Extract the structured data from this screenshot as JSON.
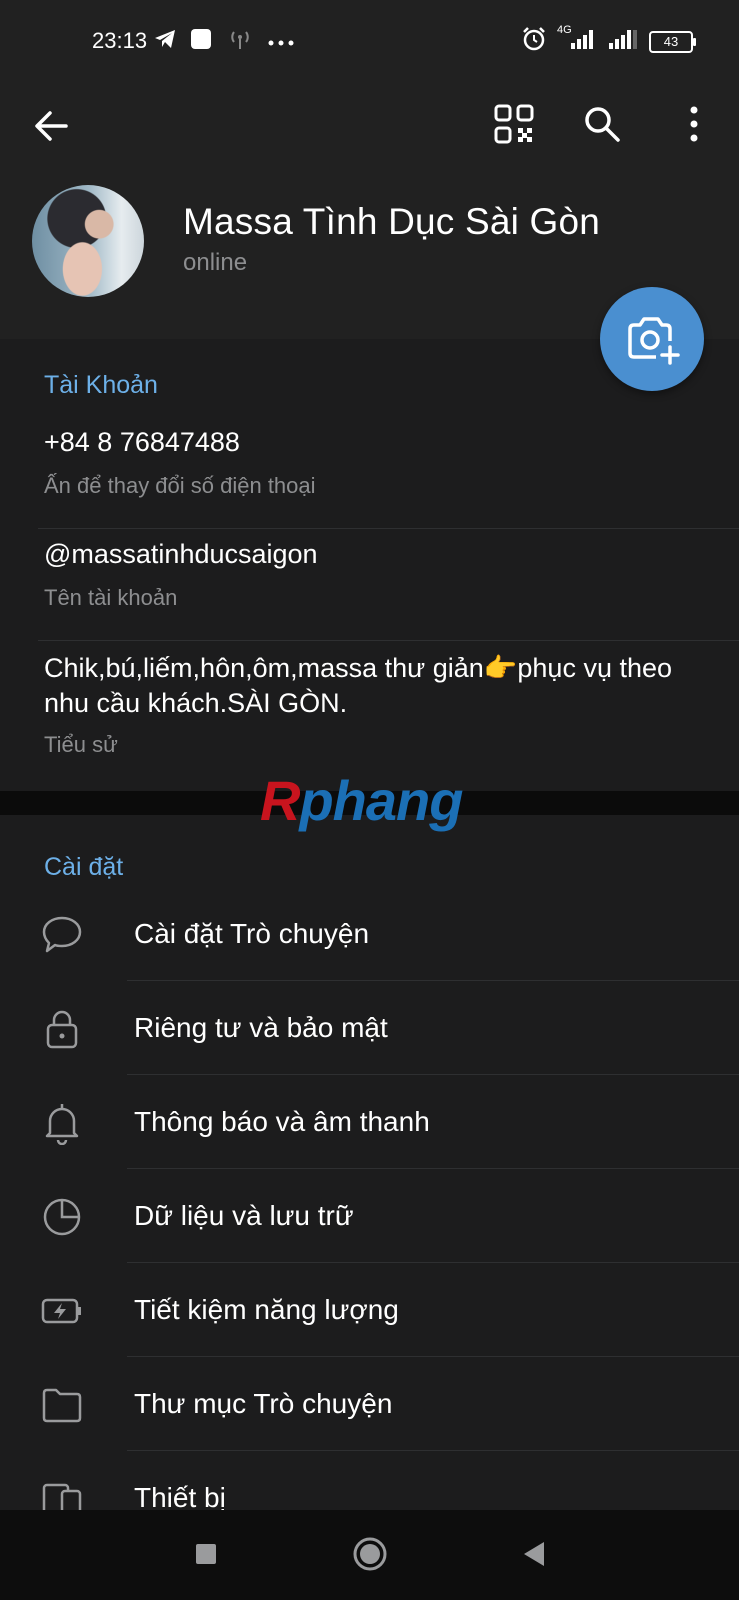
{
  "status_bar": {
    "time": "23:13",
    "network": "4G",
    "battery": "43",
    "icons": [
      "telegram-icon",
      "app-icon",
      "hotspot-icon",
      "more-dots-icon",
      "alarm-icon",
      "signal-icon",
      "signal-icon",
      "battery-icon"
    ]
  },
  "header": {
    "name": "Massa Tình Dục Sài Gòn",
    "status": "online",
    "actions": [
      "back-arrow-icon",
      "qr-code-icon",
      "search-icon",
      "more-vertical-icon"
    ],
    "fab_icon": "add-photo-icon"
  },
  "account": {
    "section_title": "Tài Khoản",
    "phone": "+84 8 76847488",
    "phone_hint": "Ấn để thay đổi số điện thoại",
    "username": "@massatinhducsaigon",
    "username_hint": "Tên tài khoản",
    "bio": "Chik,bú,liếm,hôn,ôm,massa thư giản👉phục vụ theo nhu cầu khách.SÀI GÒN.",
    "bio_hint": "Tiểu sử"
  },
  "watermark": {
    "first": "R",
    "rest": "phang"
  },
  "settings": {
    "section_title": "Cài đặt",
    "items": [
      {
        "label": "Cài đặt Trò chuyện",
        "icon": "chat-bubble-icon"
      },
      {
        "label": "Riêng tư và bảo mật",
        "icon": "lock-icon"
      },
      {
        "label": "Thông báo và âm thanh",
        "icon": "bell-icon"
      },
      {
        "label": "Dữ liệu và lưu trữ",
        "icon": "pie-chart-icon"
      },
      {
        "label": "Tiết kiệm năng lượng",
        "icon": "battery-bolt-icon"
      },
      {
        "label": "Thư mục Trò chuyện",
        "icon": "folder-icon"
      },
      {
        "label": "Thiết bị",
        "icon": "devices-icon"
      }
    ]
  },
  "colors": {
    "background": "#1c1c1d",
    "header": "#212121",
    "accent": "#6db0e8",
    "fab": "#4a8fd0",
    "secondary_text": "#8d8e90"
  },
  "nav_bar": [
    "recent-apps-icon",
    "home-icon",
    "back-icon"
  ]
}
